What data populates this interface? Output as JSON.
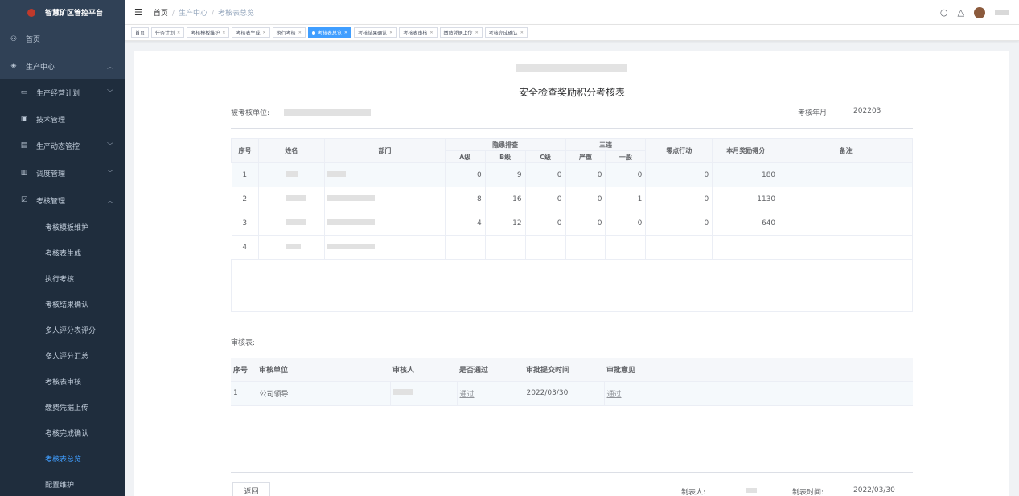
{
  "app": {
    "title": "智慧矿区管控平台"
  },
  "sidebar": {
    "items": [
      {
        "label": "首页",
        "icon": "dashboard-icon"
      },
      {
        "label": "生产中心",
        "icon": "layers-icon"
      },
      {
        "label": "生产经营计划",
        "icon": "keyboard-icon"
      },
      {
        "label": "技术管理",
        "icon": "doc-icon"
      },
      {
        "label": "生产动态管控",
        "icon": "monitor-icon"
      },
      {
        "label": "调度管理",
        "icon": "list-icon"
      },
      {
        "label": "考核管理",
        "icon": "checkbox-icon"
      }
    ],
    "leaves": [
      "考核模板维护",
      "考核表生成",
      "执行考核",
      "考核结果确认",
      "多人评分表评分",
      "多人评分汇总",
      "考核表审核",
      "缴费凭据上传",
      "考核完成确认",
      "考核表总览",
      "配置维护"
    ],
    "active_leaf": "考核表总览"
  },
  "breadcrumb": {
    "home": "首页",
    "level1": "生产中心",
    "level2": "考核表总览"
  },
  "tags": [
    "首页",
    "任务计划",
    "考核模板维护",
    "考核表生成",
    "执行考核",
    "考核表总览",
    "考核结果确认",
    "考核表审核",
    "缴费凭据上传",
    "考核完成确认"
  ],
  "active_tag": "考核表总览",
  "document": {
    "title": "安全检查奖励积分考核表",
    "unit_label": "被考核单位:",
    "month_label": "考核年月:",
    "month_value": "202203"
  },
  "main_table": {
    "headers": {
      "seq": "序号",
      "name": "姓名",
      "dept": "部门",
      "hidden_group": "隐患排查",
      "a": "A级",
      "b": "B级",
      "c": "C级",
      "violation_group": "三违",
      "severe": "严重",
      "normal": "一般",
      "zero": "零点行动",
      "score": "本月奖励得分",
      "remark": "备注"
    },
    "rows": [
      {
        "seq": "1",
        "a": "0",
        "b": "9",
        "c": "0",
        "severe": "0",
        "normal": "0",
        "zero": "0",
        "score": "180"
      },
      {
        "seq": "2",
        "a": "8",
        "b": "16",
        "c": "0",
        "severe": "0",
        "normal": "1",
        "zero": "0",
        "score": "1130"
      },
      {
        "seq": "3",
        "a": "4",
        "b": "12",
        "c": "0",
        "severe": "0",
        "normal": "0",
        "zero": "0",
        "score": "640"
      },
      {
        "seq": "4",
        "a": "",
        "b": "",
        "c": "",
        "severe": "",
        "normal": "",
        "zero": "",
        "score": ""
      }
    ]
  },
  "audit": {
    "label": "审核表:",
    "headers": {
      "seq": "序号",
      "unit": "审核单位",
      "person": "审核人",
      "passed": "是否通过",
      "time": "审批提交时间",
      "opinion": "审批意见"
    },
    "rows": [
      {
        "seq": "1",
        "unit": "公司领导",
        "passed": "通过",
        "time": "2022/03/30",
        "opinion": "通过"
      }
    ]
  },
  "footer": {
    "back_label": "返回",
    "maker_label": "制表人:",
    "time_label": "制表时间:",
    "time_value": "2022/03/30"
  }
}
